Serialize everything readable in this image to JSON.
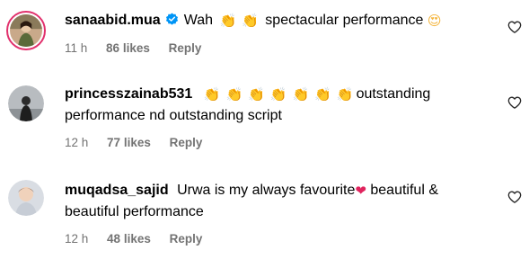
{
  "comments": [
    {
      "username": "sanaabid.mua",
      "verified": true,
      "text_segments": [
        "Wah",
        "spectacular performance"
      ],
      "emojis": {
        "after_segment_0": [
          "clapping-hands",
          "clapping-hands"
        ],
        "end": [
          "smiling-face-with-heart-eyes"
        ]
      },
      "time": "11 h",
      "likes": "86 likes",
      "reply": "Reply"
    },
    {
      "username": "princesszainab531",
      "verified": false,
      "emojis_before_text": [
        "clapping-hands",
        "clapping-hands",
        "clapping-hands",
        "clapping-hands",
        "clapping-hands",
        "clapping-hands",
        "clapping-hands"
      ],
      "text": "outstanding performance nd outstanding script",
      "time": "12 h",
      "likes": "77 likes",
      "reply": "Reply"
    },
    {
      "username": "muqadsa_sajid",
      "verified": false,
      "text_segments": [
        "Urwa is my always favourite",
        "beautiful & beautiful performance"
      ],
      "emojis": {
        "after_segment_0": [
          "red-heart"
        ]
      },
      "time": "12 h",
      "likes": "48 likes",
      "reply": "Reply"
    }
  ],
  "colors": {
    "meta_text": "#737373",
    "verified_badge": "#0095f6",
    "avatar_ring": "#e1306c"
  },
  "icons": {
    "like": "heart-outline-icon",
    "verified": "verified-badge-icon"
  },
  "emoji_glyphs": {
    "clap": "👏",
    "heart_eyes": "😍",
    "red_heart": "❤"
  }
}
